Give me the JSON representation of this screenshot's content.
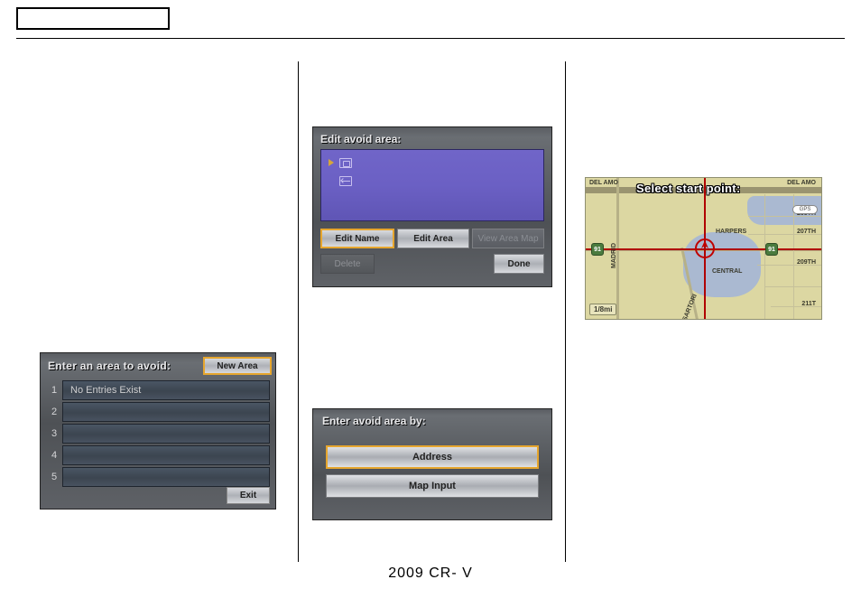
{
  "footer": "2009  CR- V",
  "screen1": {
    "title": "Enter an area to avoid:",
    "new_area": "New Area",
    "rows": [
      {
        "n": "1",
        "text": "No Entries Exist"
      },
      {
        "n": "2",
        "text": ""
      },
      {
        "n": "3",
        "text": ""
      },
      {
        "n": "4",
        "text": ""
      },
      {
        "n": "5",
        "text": ""
      }
    ],
    "exit": "Exit"
  },
  "screen2": {
    "title": "Edit avoid area:",
    "edit_name": "Edit Name",
    "edit_area": "Edit Area",
    "view_map": "View Area Map",
    "delete": "Delete",
    "done": "Done"
  },
  "screen3": {
    "title": "Enter avoid area by:",
    "address": "Address",
    "map_input": "Map Input"
  },
  "screen4": {
    "banner": "Select start point:",
    "scale": "1/8mi",
    "gps": "GPS",
    "shield_left": "91",
    "shield_right": "91",
    "labels": {
      "del_amo_l": "DEL AMO",
      "del_amo_r": "DEL AMO",
      "madrid": "MADRID",
      "harpers": "HARPERS",
      "central": "CENTRAL",
      "sartori": "SARTORI",
      "s205": "205TH",
      "s207": "207TH",
      "s209": "209TH",
      "s211": "211T"
    }
  }
}
